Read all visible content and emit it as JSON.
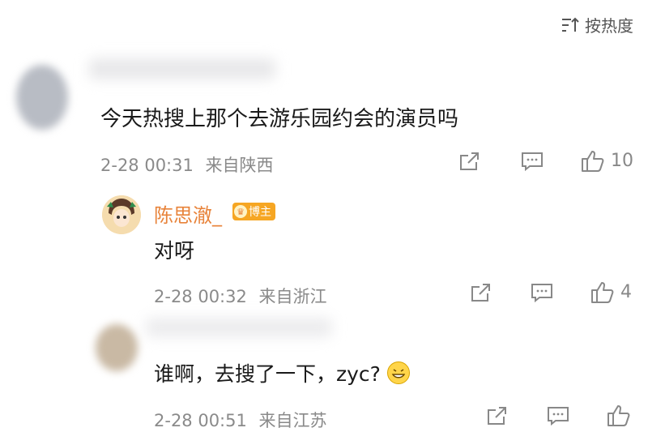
{
  "header": {
    "sort_label": "按热度"
  },
  "comment": {
    "text": "今天热搜上那个去游乐园约会的演员吗",
    "time": "2-28 00:31",
    "location": "来自陕西",
    "likes": "10"
  },
  "replies": [
    {
      "name": "陈思澈_",
      "badge": "博主",
      "text": "对呀",
      "time": "2-28 00:32",
      "location": "来自浙江",
      "likes": "4"
    },
    {
      "text": "谁啊，去搜了一下，zyc?",
      "time": "2-28 00:51",
      "location": "来自江苏"
    }
  ]
}
